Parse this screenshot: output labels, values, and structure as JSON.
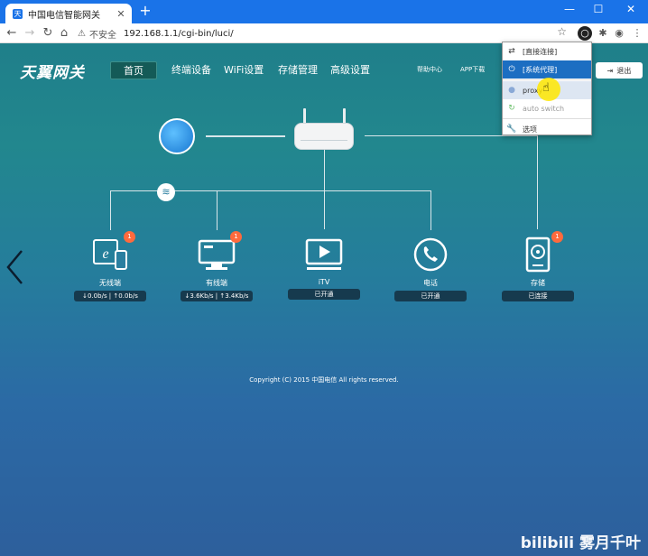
{
  "browser": {
    "tab_title": "中国电信智能网关",
    "tab_close": "✕",
    "new_tab": "+",
    "window_controls": [
      "—",
      "☐",
      "✕"
    ],
    "security_label": "不安全",
    "url": "192.168.1.1/cgi-bin/luci/"
  },
  "nav": {
    "logo": "天翼网关",
    "items": [
      "首页",
      "终端设备",
      "WiFi设置",
      "存储管理",
      "高级设置"
    ],
    "help": "帮助中心",
    "app": "APP下载",
    "logout": "退出"
  },
  "devices": [
    {
      "label": "无线端",
      "status": "↓0.0b/s | ↑0.0b/s",
      "badge": "1"
    },
    {
      "label": "有线端",
      "status": "↓3.6Kb/s | ↑3.4Kb/s",
      "badge": "1"
    },
    {
      "label": "iTV",
      "status": "已开通"
    },
    {
      "label": "电话",
      "status": "已开通"
    },
    {
      "label": "存储",
      "status": "已连接",
      "badge": "1"
    }
  ],
  "copyright": "Copyright (C) 2015 中国电信 All rights reserved.",
  "watermark": "bilibili 雾月千叶",
  "popup": {
    "items": [
      {
        "label": "[直接连接]",
        "icon": "⇄"
      },
      {
        "label": "[系统代理]",
        "icon": "⏻"
      },
      {
        "label": "proxy",
        "icon": "●"
      },
      {
        "label": "auto switch",
        "icon": "↻"
      },
      {
        "label": "选项",
        "icon": "🔧"
      }
    ]
  }
}
